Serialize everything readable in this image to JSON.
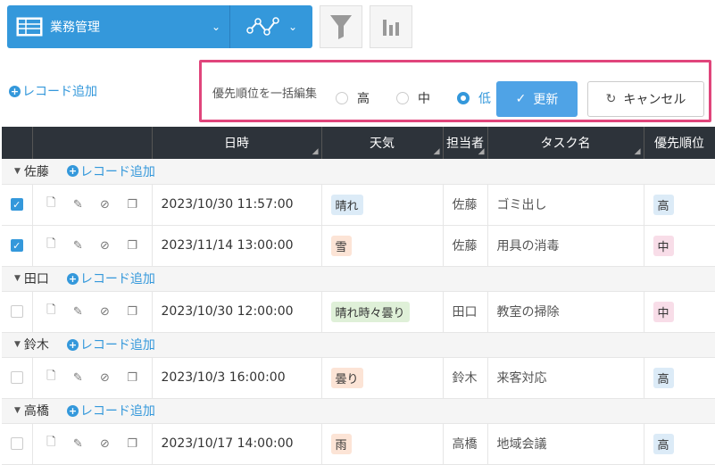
{
  "toolbar": {
    "view_title": "業務管理",
    "graph_dropdown_icon": "chevron-down-icon",
    "filter_icon": "filter-icon",
    "chart_icon": "bar-chart-icon"
  },
  "add_record_label": "レコード追加",
  "bulk_edit": {
    "label": "優先順位を一括編集",
    "options": [
      "高",
      "中",
      "低"
    ],
    "selected": "低",
    "update_label": "更新",
    "cancel_label": "キャンセル"
  },
  "table": {
    "headers": [
      "日時",
      "天気",
      "担当者",
      "タスク名",
      "優先順位"
    ],
    "groups": [
      {
        "name": "佐藤",
        "add_label": "レコード追加",
        "rows": [
          {
            "checked": true,
            "datetime": "2023/10/30 11:57:00",
            "weather": "晴れ",
            "weather_color": "#dcebf7",
            "person": "佐藤",
            "task": "ゴミ出し",
            "priority": "高",
            "priority_color": "#dcebf7"
          },
          {
            "checked": true,
            "datetime": "2023/11/14 13:00:00",
            "weather": "雪",
            "weather_color": "#fce4d6",
            "person": "佐藤",
            "task": "用具の消毒",
            "priority": "中",
            "priority_color": "#f8dde8"
          }
        ]
      },
      {
        "name": "田口",
        "add_label": "レコード追加",
        "rows": [
          {
            "checked": false,
            "datetime": "2023/10/30 12:00:00",
            "weather": "晴れ時々曇り",
            "weather_color": "#dff0d8",
            "person": "田口",
            "task": "教室の掃除",
            "priority": "中",
            "priority_color": "#f8dde8"
          }
        ]
      },
      {
        "name": "鈴木",
        "add_label": "レコード追加",
        "rows": [
          {
            "checked": false,
            "datetime": "2023/10/3 16:00:00",
            "weather": "曇り",
            "weather_color": "#fce4d6",
            "person": "鈴木",
            "task": "来客対応",
            "priority": "高",
            "priority_color": "#dcebf7"
          }
        ]
      },
      {
        "name": "高橋",
        "add_label": "レコード追加",
        "rows": [
          {
            "checked": false,
            "datetime": "2023/10/17 14:00:00",
            "weather": "雨",
            "weather_color": "#fce4d6",
            "person": "高橋",
            "task": "地域会議",
            "priority": "高",
            "priority_color": "#dcebf7"
          }
        ]
      }
    ]
  },
  "colors": {
    "accent": "#3498db",
    "highlight_border": "#e0457b",
    "header_bg": "#2d333a"
  }
}
